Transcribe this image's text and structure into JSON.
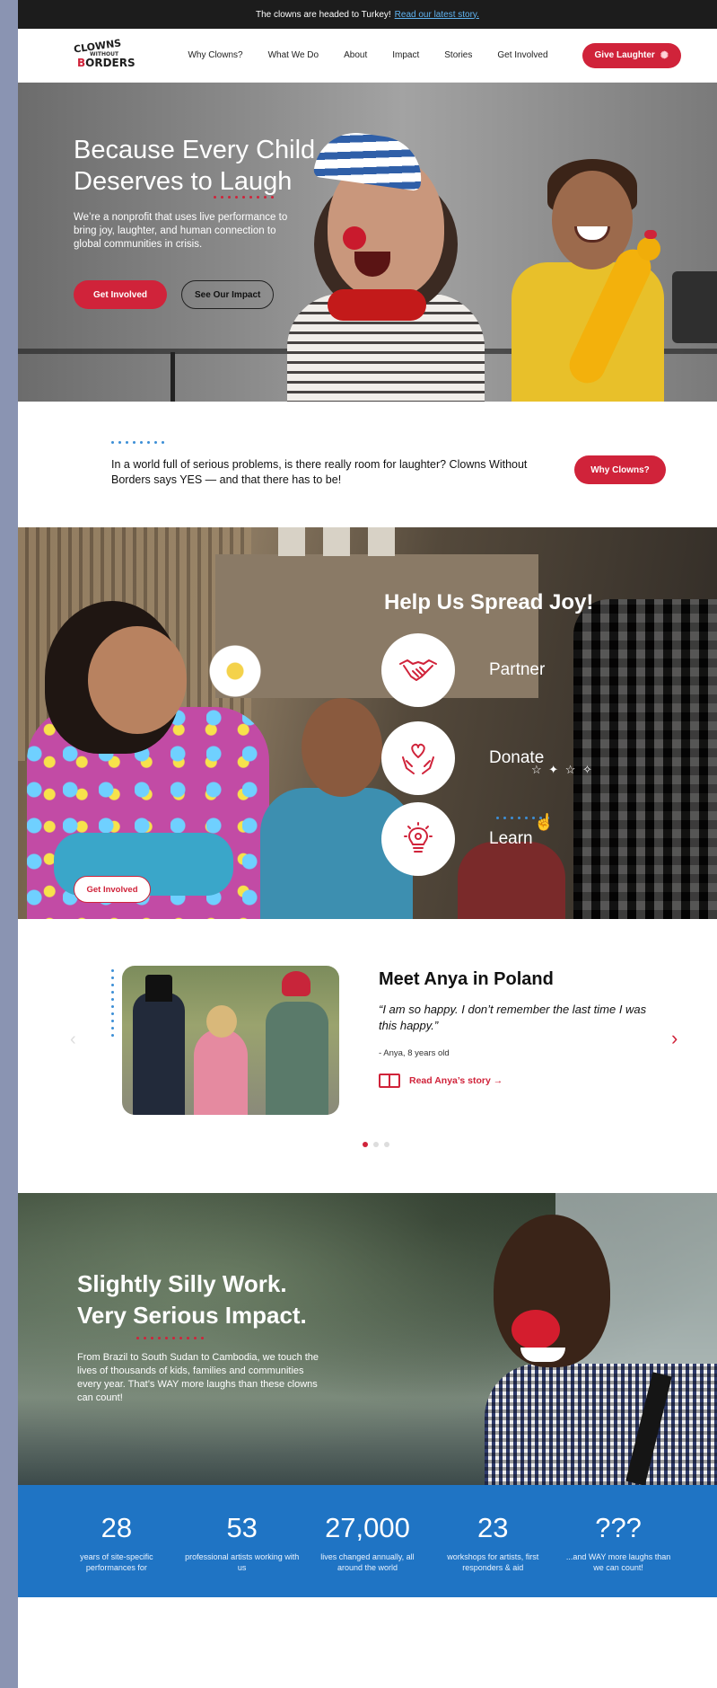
{
  "announcement": {
    "text": "The clowns are headed to Turkey!",
    "link": "Read our latest story."
  },
  "header": {
    "logo": {
      "line1": "CLOWNS",
      "line2": "WITHOUT",
      "line3a": "B",
      "line3b": "RDERS"
    },
    "nav": [
      "Why Clowns?",
      "What We Do",
      "About",
      "Impact",
      "Stories",
      "Get Involved"
    ],
    "cta": "Give Laughter"
  },
  "hero": {
    "title_line1": "Because Every Child",
    "title_line2": "Deserves to Laugh",
    "subtitle": "We’re a nonprofit that uses live performance to bring joy, laughter, and human connection to global communities in crisis.",
    "primary_button": "Get Involved",
    "secondary_button": "See Our Impact"
  },
  "intro": {
    "text": "In a world full of serious problems, is there really room for laughter? Clowns Without Borders says YES — and that there has to be!",
    "button": "Why Clowns?"
  },
  "joy": {
    "title": "Help Us Spread Joy!",
    "items": [
      {
        "label": "Partner",
        "icon": "handshake-icon"
      },
      {
        "label": "Donate",
        "icon": "heart-hands-icon"
      },
      {
        "label": "Learn",
        "icon": "lightbulb-icon"
      }
    ],
    "button": "Get Involved"
  },
  "story": {
    "title": "Meet Anya in Poland",
    "quote": "“I am so happy. I don’t remember the last time I was this happy.”",
    "author": "- Anya, 8 years old",
    "link": "Read Anya’s story →",
    "prev": "‹",
    "next": "›"
  },
  "impact": {
    "title_line1": "Slightly Silly Work.",
    "title_line2": "Very Serious Impact.",
    "text": "From Brazil to South Sudan to Cambodia, we touch the lives of thousands of kids, families and communities every year. That’s WAY more laughs than these clowns can count!"
  },
  "stats": [
    {
      "number": "28",
      "label": "years of site-specific performances for"
    },
    {
      "number": "53",
      "label": "professional artists working with us"
    },
    {
      "number": "27,000",
      "label": "lives changed annually, all around the world"
    },
    {
      "number": "23",
      "label": "workshops for artists, first responders & aid"
    },
    {
      "number": "???",
      "label": "...and WAY more laughs than we can count!"
    }
  ],
  "colors": {
    "brand_red": "#d0233a",
    "accent_blue": "#1f74c4",
    "dot_blue": "#3d8fd6"
  }
}
